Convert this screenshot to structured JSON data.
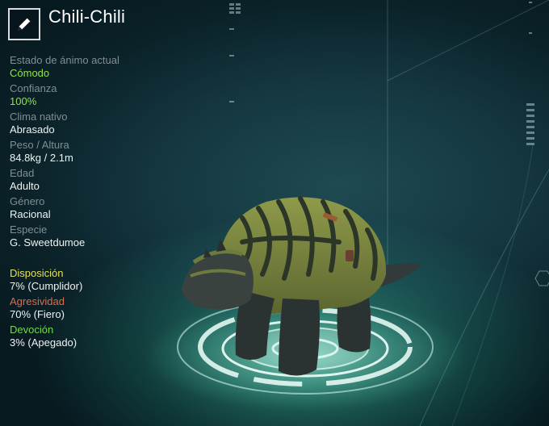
{
  "creature": {
    "name": "Chili-Chili"
  },
  "stats": [
    {
      "label": "Estado de ánimo actual",
      "value": "Cómodo"
    },
    {
      "label": "Confianza",
      "value": "100%"
    },
    {
      "label": "Clima nativo",
      "value": "Abrasado"
    },
    {
      "label": "Peso / Altura",
      "value": "84.8kg / 2.1m"
    },
    {
      "label": "Edad",
      "value": "Adulto"
    },
    {
      "label": "Género",
      "value": "Racional"
    },
    {
      "label": "Especie",
      "value": "G. Sweetdumoe"
    }
  ],
  "traits": [
    {
      "label": "Disposición",
      "value": "7% (Cumplidor)"
    },
    {
      "label": "Agresividad",
      "value": "70% (Fiero)"
    },
    {
      "label": "Devoción",
      "value": "3% (Apegado)"
    }
  ],
  "colors": {
    "positive_value": "#8fe34a",
    "disposition_label": "#e4e05a",
    "aggression_label": "#e06a4a",
    "devotion_label": "#6fdc4a"
  },
  "icons": {
    "edit": "pencil-icon"
  }
}
